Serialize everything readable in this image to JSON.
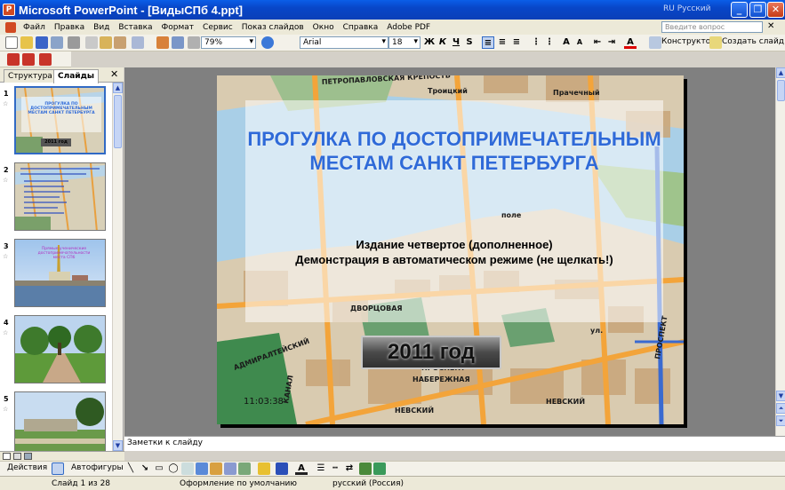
{
  "window": {
    "title": "Microsoft PowerPoint - [ВидыСПб 4.ppt]",
    "language_indicator": "RU Русский",
    "app_letter": "P"
  },
  "menu": {
    "items": [
      "Файл",
      "Правка",
      "Вид",
      "Вставка",
      "Формат",
      "Сервис",
      "Показ слайдов",
      "Окно",
      "Справка",
      "Adobe PDF"
    ],
    "help_placeholder": "Введите вопрос",
    "close_glyph": "✕"
  },
  "toolbar": {
    "zoom": "79%",
    "font": "Arial",
    "size": "18",
    "bold": "Ж",
    "italic": "К",
    "underline": "Ч",
    "shadow": "S",
    "grow": "A",
    "shrink": "A",
    "designer": "Конструктор",
    "new_slide": "Создать слайд"
  },
  "panel": {
    "tab_outline": "Структура",
    "tab_slides": "Слайды",
    "close_glyph": "✕",
    "thumbnails": [
      {
        "number": "1",
        "star": "☆"
      },
      {
        "number": "2",
        "star": "☆"
      },
      {
        "number": "3",
        "star": "☆"
      },
      {
        "number": "4",
        "star": "☆"
      },
      {
        "number": "5",
        "star": "☆"
      }
    ],
    "thumb1": {
      "title": "ПРОГУЛКА ПО ДОСТОПРИМЕЧАТЕЛЬНЫМ МЕСТАМ САНКТ ПЕТЕРБУРГА",
      "year": "2011 год"
    },
    "thumb3": {
      "title": "Прямые ученические достопримечательности места СПб"
    }
  },
  "slide": {
    "title": "ПРОГУЛКА ПО ДОСТОПРИМЕЧАТЕЛЬНЫМ МЕСТАМ САНКТ ПЕТЕРБУРГА",
    "subtitle_line1": "Издание четвертое (дополненное)",
    "subtitle_line2": "Демонстрация в автоматическом режиме (не щелкать!)",
    "year": "2011 год",
    "time": "11:03:38",
    "map_labels": [
      "ПЕТРОПАВЛОВСКАЯ КРЕПОСТЬ",
      "Троицкий",
      "Прачечный",
      "поле",
      "НЕВСКИЙ",
      "ПРОСПЕКТ",
      "НЕВСКИЙ",
      "АДМИРАЛТЕЙСКИЙ",
      "КАНАЛ",
      "НАБЕРЕЖНАЯ",
      "ПРОСПЕКТ",
      "ДВОРЦОВАЯ",
      "ул."
    ]
  },
  "notes": {
    "placeholder": "Заметки к слайду"
  },
  "drawing": {
    "actions": "Действия",
    "autoshapes": "Автофигуры"
  },
  "status": {
    "slide": "Слайд 1 из 28",
    "design": "Оформление по умолчанию",
    "language": "русский (Россия)"
  },
  "colors": {
    "title_blue": "#2f6ad8",
    "titlebar": "#0a5ee8",
    "selection": "#316ac5"
  }
}
